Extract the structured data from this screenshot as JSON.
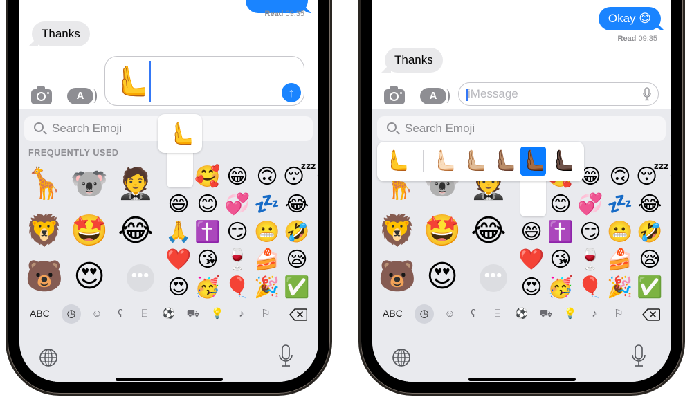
{
  "colors": {
    "accent_blue": "#1a84ff",
    "incoming_bubble": "#e9e9eb",
    "keyboard_bg": "#e9eaee",
    "selected_skin_tone": "#0a7cff"
  },
  "left_screen": {
    "outgoing_receipt": {
      "label": "Read",
      "time": "09:35"
    },
    "incoming_message": "Thanks",
    "composer": {
      "typed_emoji": "🫷",
      "send_icon": "arrow-up-icon",
      "send_glyph": "↑"
    },
    "emoji_popup": {
      "emoji": "🫷"
    }
  },
  "right_screen": {
    "outgoing_message": "Okay 😊",
    "outgoing_receipt": {
      "label": "Read",
      "time": "09:35"
    },
    "incoming_message": "Thanks",
    "composer": {
      "placeholder": "iMessage"
    },
    "skin_tone_picker": {
      "default": "🫷",
      "tones": [
        "🫷🏻",
        "🫷🏼",
        "🫷🏽",
        "🫷🏾",
        "🫷🏿"
      ],
      "selected_index": 3
    }
  },
  "keyboard": {
    "search_placeholder": "Search Emoji",
    "section_label": "FREQUENTLY USED",
    "memoji": [
      "🦒",
      "🐨",
      "🤵",
      "🦁",
      "🤩",
      "😂",
      "🐻",
      "😍"
    ],
    "more_label": "•••",
    "emoji_rows": [
      [
        "🥰",
        "😁",
        "🙃",
        "😴",
        "😊"
      ],
      [
        "😄",
        "😊",
        "💞",
        "💤",
        "😂"
      ],
      [
        "🙏",
        "✝️",
        "😏",
        "😬",
        "🤣"
      ],
      [
        "❤️",
        "😘",
        "🍷",
        "🍰",
        "😪"
      ],
      [
        "😍",
        "🥳",
        "🎈",
        "🎉",
        "✅"
      ]
    ],
    "categories": {
      "abc_label": "ABC",
      "icons": [
        {
          "name": "recent-clock-icon",
          "glyph": "◷"
        },
        {
          "name": "smiley-icon",
          "glyph": "☺"
        },
        {
          "name": "animal-icon",
          "glyph": "ʕ"
        },
        {
          "name": "food-icon",
          "glyph": "⌸"
        },
        {
          "name": "soccer-ball-icon",
          "glyph": "⚽"
        },
        {
          "name": "travel-car-icon",
          "glyph": "⛟"
        },
        {
          "name": "lightbulb-icon",
          "glyph": "💡"
        },
        {
          "name": "symbols-icon",
          "glyph": "♪"
        },
        {
          "name": "flag-icon",
          "glyph": "⚐"
        }
      ],
      "active_index": 0
    }
  }
}
